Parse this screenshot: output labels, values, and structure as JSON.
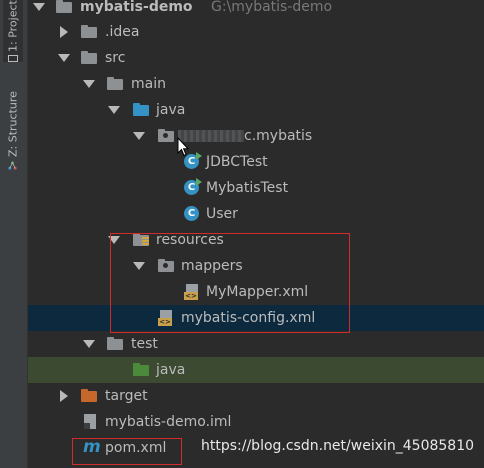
{
  "sidebar": {
    "project_tab": "1: Project",
    "structure_tab": "Z: Structure"
  },
  "tree": {
    "project_name": "mybatis-demo",
    "project_path": "G:\\mybatis-demo",
    "idea": ".idea",
    "src": "src",
    "main": "main",
    "java": "java",
    "package": "c.mybatis",
    "jdbc_test": "JDBCTest",
    "mybatis_test": "MybatisTest",
    "user": "User",
    "resources": "resources",
    "mappers": "mappers",
    "my_mapper": "MyMapper.xml",
    "mybatis_config": "mybatis-config.xml",
    "test": "test",
    "test_java": "java",
    "target": "target",
    "iml": "mybatis-demo.iml",
    "pom": "pom.xml"
  },
  "class_icon_letter": "C",
  "xml_icon_glyph": "<>",
  "maven_icon_glyph": "m",
  "watermark": "https://blog.csdn.net/weixin_45085810",
  "colors": {
    "background": "#2b2b2b",
    "selection": "#0d293e",
    "highlight_box": "#d12b2b"
  }
}
